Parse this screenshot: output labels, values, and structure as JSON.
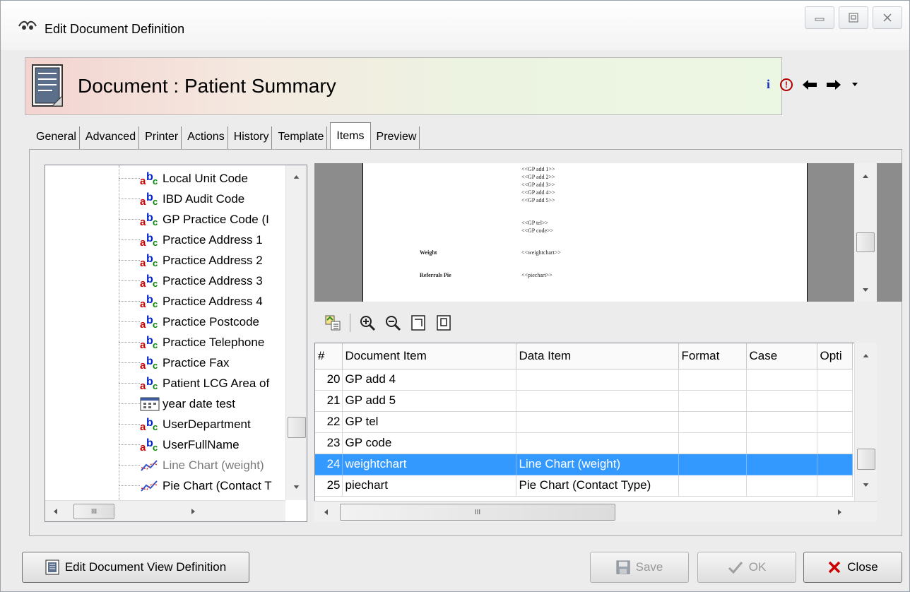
{
  "window": {
    "title": "Edit Document Definition",
    "controls": {
      "minimize_icon": "minimize-icon",
      "maximize_icon": "maximize-icon",
      "close_icon": "close-icon"
    }
  },
  "header": {
    "title": "Document : Patient Summary",
    "icons": [
      "info-icon",
      "warning-icon",
      "back-arrow-icon",
      "forward-arrow-icon",
      "dropdown-arrow-icon"
    ]
  },
  "tabs": [
    {
      "label": "General"
    },
    {
      "label": "Advanced"
    },
    {
      "label": "Printer"
    },
    {
      "label": "Actions"
    },
    {
      "label": "History"
    },
    {
      "label": "Template"
    },
    {
      "label": "Items",
      "active": true
    },
    {
      "label": "Preview"
    }
  ],
  "tree": {
    "items": [
      {
        "label": "Local Unit Code",
        "icon": "text-field-icon"
      },
      {
        "label": "IBD Audit Code",
        "icon": "text-field-icon"
      },
      {
        "label": "GP Practice Code (I",
        "icon": "text-field-icon"
      },
      {
        "label": "Practice Address 1",
        "icon": "text-field-icon"
      },
      {
        "label": "Practice Address 2",
        "icon": "text-field-icon"
      },
      {
        "label": "Practice Address 3",
        "icon": "text-field-icon"
      },
      {
        "label": "Practice Address 4",
        "icon": "text-field-icon"
      },
      {
        "label": "Practice Postcode",
        "icon": "text-field-icon"
      },
      {
        "label": "Practice Telephone",
        "icon": "text-field-icon"
      },
      {
        "label": "Practice Fax",
        "icon": "text-field-icon"
      },
      {
        "label": "Patient LCG Area of",
        "icon": "text-field-icon"
      },
      {
        "label": "year date test",
        "icon": "calendar-icon"
      },
      {
        "label": "UserDepartment",
        "icon": "text-field-icon"
      },
      {
        "label": "UserFullName",
        "icon": "text-field-icon"
      },
      {
        "label": "Line Chart (weight)",
        "icon": "line-chart-icon"
      },
      {
        "label": "Pie Chart (Contact T",
        "icon": "line-chart-icon"
      }
    ],
    "hscroll_grip": "III"
  },
  "preview": {
    "lines": [
      "<<GP add 1>>",
      "<<GP add 2>>",
      "<<GP add 3>>",
      "<<GP add 4>>",
      "<<GP add 5>>",
      "<<GP tel>>",
      "<<GP code>>"
    ],
    "weight_label": "Weight",
    "weight_field_prefix": "<<",
    "weight_field_selected": "weightchart",
    "weight_field_suffix": ">>",
    "referrals_label": "Referrals Pie",
    "referrals_field": "<<piechart>>"
  },
  "toolbar": {
    "icons": [
      "insert-field-icon",
      "zoom-in-icon",
      "zoom-out-icon",
      "page-width-icon",
      "whole-page-icon"
    ]
  },
  "grid": {
    "columns": [
      "#",
      "Document Item",
      "Data Item",
      "Format",
      "Case",
      "Opti"
    ],
    "rows": [
      {
        "num": "20",
        "item": "GP add 4",
        "data": ""
      },
      {
        "num": "21",
        "item": "GP add 5",
        "data": ""
      },
      {
        "num": "22",
        "item": "GP tel",
        "data": ""
      },
      {
        "num": "23",
        "item": "GP code",
        "data": ""
      },
      {
        "num": "24",
        "item": "weightchart",
        "data": "Line Chart (weight)",
        "selected": true
      },
      {
        "num": "25",
        "item": "piechart",
        "data": "Pie Chart (Contact Type)"
      }
    ],
    "hscroll_grip": "III"
  },
  "buttons": {
    "edit_view": "Edit Document View Definition",
    "save": "Save",
    "ok": "OK",
    "close": "Close"
  },
  "colors": {
    "selection": "#3399ff",
    "banner_start": "#f3d3d0",
    "banner_end": "#ecf7e3",
    "close_x": "#cc0000"
  }
}
